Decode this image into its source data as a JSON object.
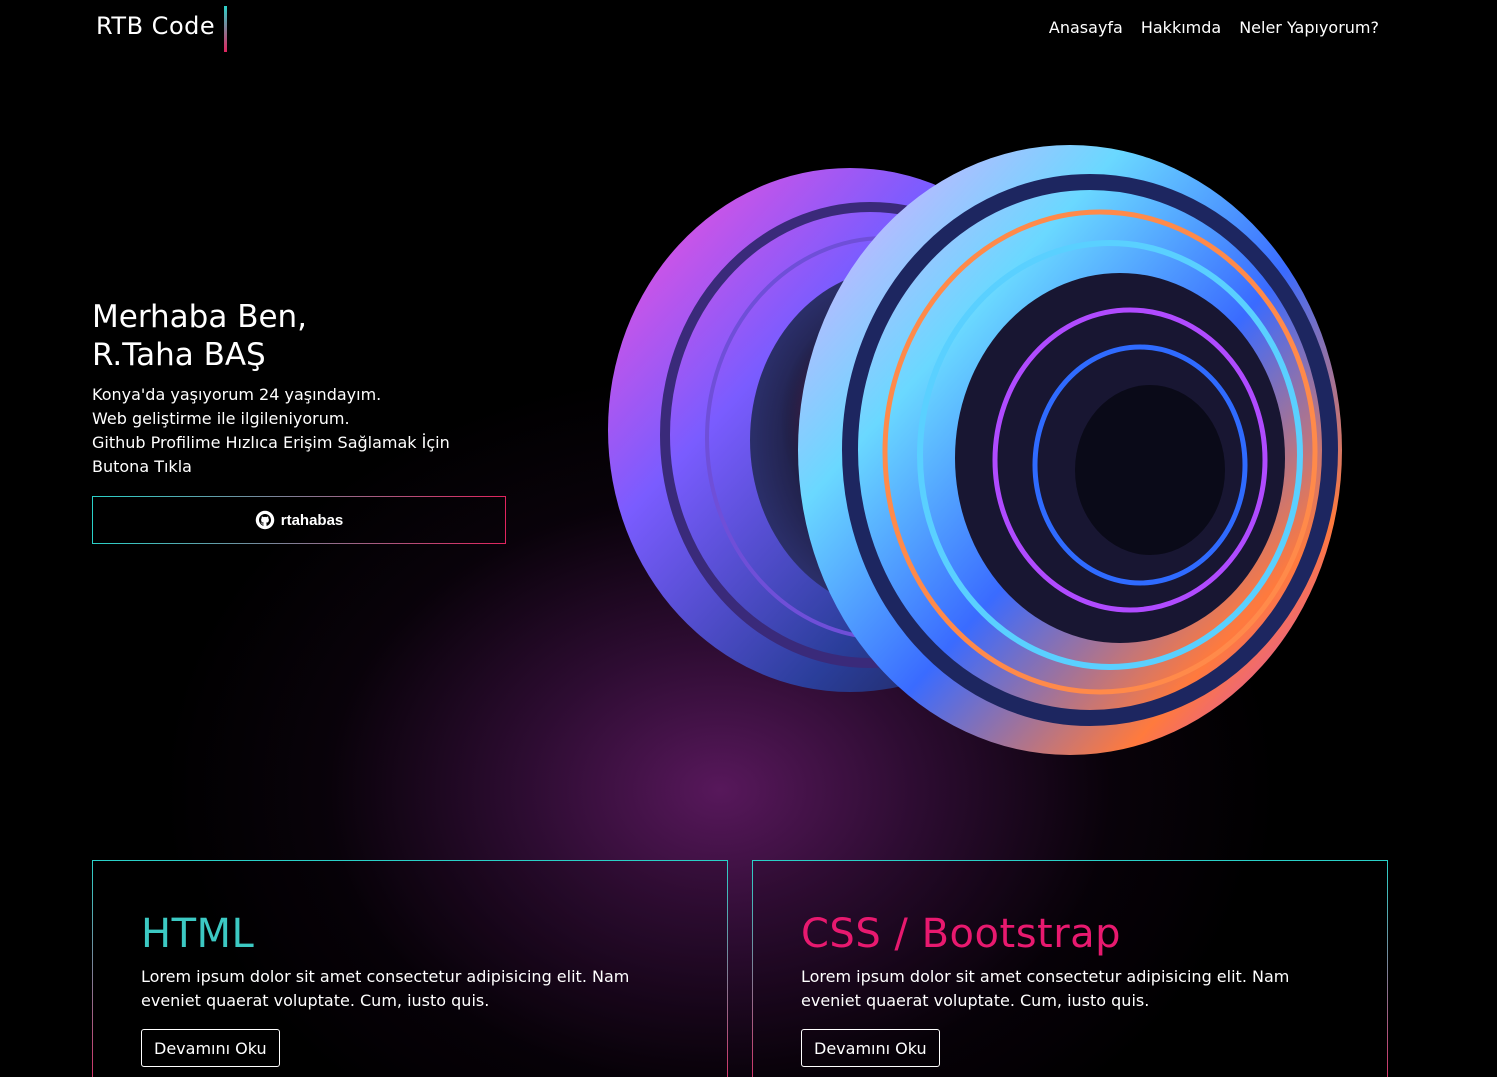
{
  "nav": {
    "brand": "RTB Code",
    "links": [
      "Anasayfa",
      "Hakkımda",
      "Neler Yapıyorum?"
    ]
  },
  "hero": {
    "title_line1": "Merhaba Ben,",
    "title_line2": "R.Taha BAŞ",
    "lines": [
      "Konya'da yaşıyorum 24 yaşındayım.",
      "Web geliştirme ile ilgileniyorum.",
      "Github Profilime Hızlıca Erişim Sağlamak İçin",
      "Butona Tıkla"
    ],
    "github_button": {
      "icon": "github-icon",
      "label": "rtahabas"
    }
  },
  "cards": [
    {
      "title": "HTML",
      "title_color": "#3cc9c3",
      "text": "Lorem ipsum dolor sit amet consectetur adipisicing elit. Nam eveniet quaerat voluptate. Cum, iusto quis.",
      "button": "Devamını Oku"
    },
    {
      "title": "CSS / Bootstrap",
      "title_color": "#e8196f",
      "text": "Lorem ipsum dolor sit amet consectetur adipisicing elit. Nam eveniet quaerat voluptate. Cum, iusto quis.",
      "button": "Devamını Oku"
    }
  ],
  "colors": {
    "accent_teal": "#2ad1c8",
    "accent_pink": "#e0245e",
    "background": "#000000"
  }
}
